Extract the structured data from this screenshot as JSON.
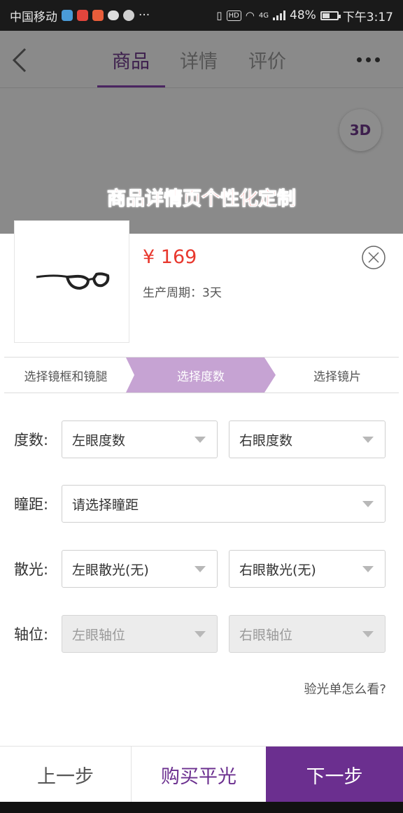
{
  "status_bar": {
    "carrier": "中国移动",
    "overflow": "···",
    "hd": "HD",
    "network": "4G",
    "battery": "48%",
    "battery_level": 0.48,
    "time": "下午3:17"
  },
  "nav": {
    "tabs": [
      "商品",
      "详情",
      "评价"
    ],
    "active_tab": "商品"
  },
  "btn_3d": "3D",
  "banner": "商品详情页个性化定制",
  "product": {
    "price": "¥ 169",
    "production_cycle": "生产周期：3天"
  },
  "steps": [
    "选择镜框和镜腿",
    "选择度数",
    "选择镜片"
  ],
  "active_step": "选择度数",
  "form": {
    "degree": {
      "label": "度数:",
      "left": "左眼度数",
      "right": "右眼度数"
    },
    "pd": {
      "label": "瞳距:",
      "value": "请选择瞳距"
    },
    "astig": {
      "label": "散光:",
      "left": "左眼散光(无)",
      "right": "右眼散光(无)"
    },
    "axis": {
      "label": "轴位:",
      "left": "左眼轴位",
      "right": "右眼轴位"
    }
  },
  "help_link": "验光单怎么看?",
  "bottom_bar": {
    "prev": "上一步",
    "buy_flat": "购买平光",
    "next": "下一步"
  },
  "colors": {
    "accent": "#6b2f8f",
    "step_active": "#c6a3d3",
    "price": "#e8382e",
    "banner": "#ff1a1a"
  }
}
